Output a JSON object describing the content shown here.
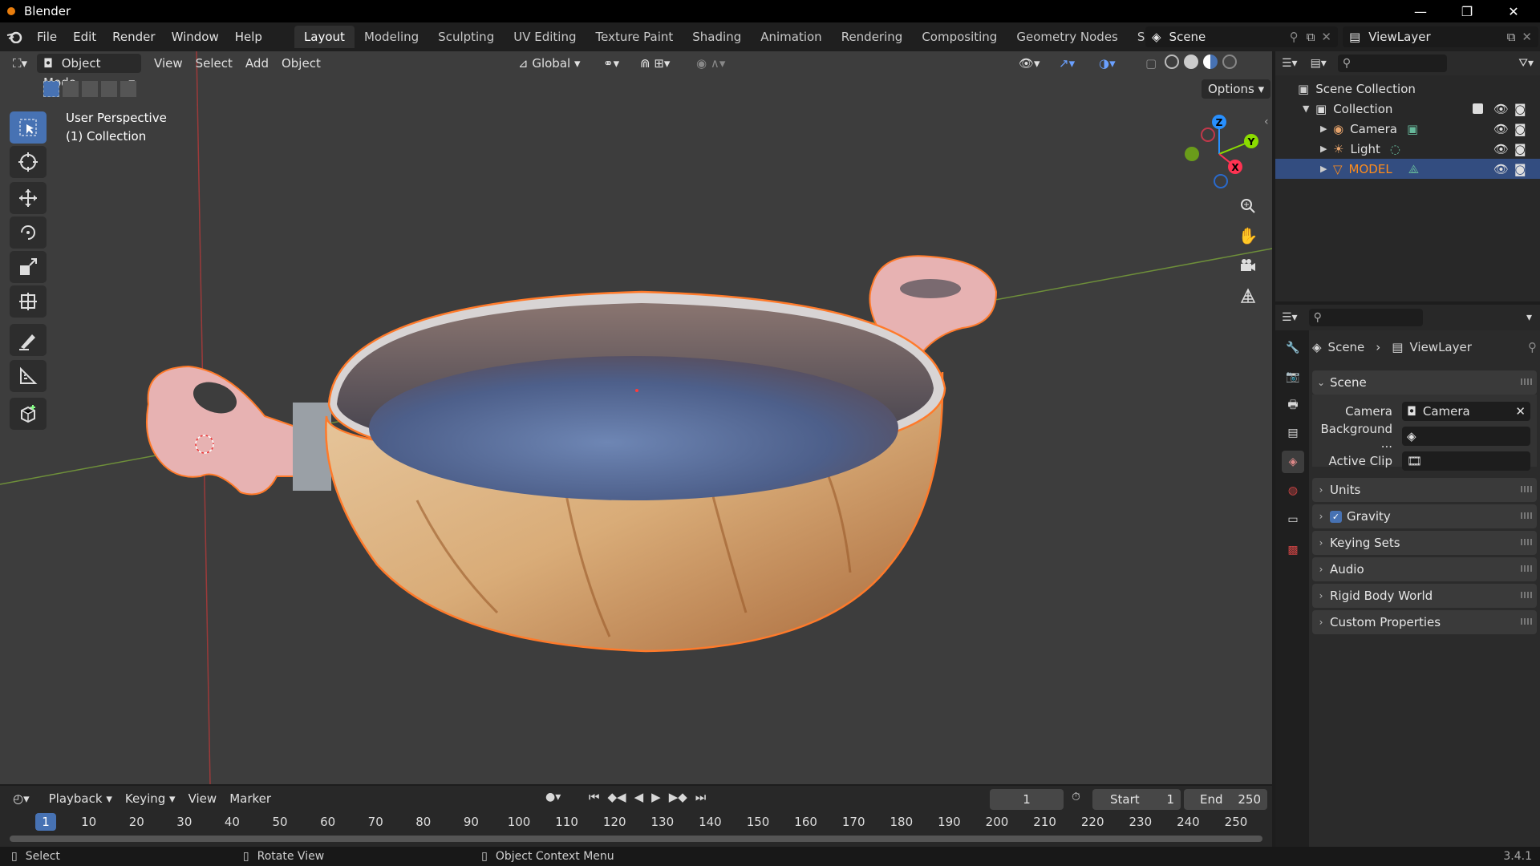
{
  "app": {
    "title": "Blender",
    "version": "3.4.1"
  },
  "menu": [
    "File",
    "Edit",
    "Render",
    "Window",
    "Help"
  ],
  "workspaces": [
    "Layout",
    "Modeling",
    "Sculpting",
    "UV Editing",
    "Texture Paint",
    "Shading",
    "Animation",
    "Rendering",
    "Compositing",
    "Geometry Nodes",
    "Scripting"
  ],
  "active_workspace": "Layout",
  "scene_name": "Scene",
  "view_layer": "ViewLayer",
  "viewport": {
    "mode": "Object Mode",
    "menus": [
      "View",
      "Select",
      "Add",
      "Object"
    ],
    "transform_orientation": "Global",
    "options_label": "Options",
    "overlay_line1": "User Perspective",
    "overlay_line2": "(1) Collection",
    "gizmo_axes": [
      "Z",
      "Y",
      "X"
    ]
  },
  "outliner": {
    "root": "Scene Collection",
    "collection": "Collection",
    "items": [
      {
        "name": "Camera",
        "color": "#e6a36b"
      },
      {
        "name": "Light",
        "color": "#e6a36b"
      },
      {
        "name": "MODEL",
        "color": "#ff8c1a"
      }
    ]
  },
  "properties": {
    "breadcrumb_scene": "Scene",
    "breadcrumb_layer": "ViewLayer",
    "panel_title": "Scene",
    "fields": [
      {
        "label": "Camera",
        "value": "Camera"
      },
      {
        "label": "Background ...",
        "value": ""
      },
      {
        "label": "Active Clip",
        "value": ""
      }
    ],
    "subpanels": [
      "Units",
      "Gravity",
      "Keying Sets",
      "Audio",
      "Rigid Body World",
      "Custom Properties"
    ],
    "gravity_checked": true
  },
  "timeline": {
    "menus": [
      "Playback",
      "Keying",
      "View",
      "Marker"
    ],
    "current_frame": "1",
    "start_label": "Start",
    "start_value": "1",
    "end_label": "End",
    "end_value": "250",
    "ticks": [
      "1",
      "10",
      "20",
      "30",
      "40",
      "50",
      "60",
      "70",
      "80",
      "90",
      "100",
      "110",
      "120",
      "130",
      "140",
      "150",
      "160",
      "170",
      "180",
      "190",
      "200",
      "210",
      "220",
      "230",
      "240",
      "250"
    ]
  },
  "statusbar": {
    "select": "Select",
    "rotate": "Rotate View",
    "context": "Object Context Menu"
  },
  "colors": {
    "accent": "#4772b3",
    "selected_orange": "#ff8c1a",
    "x_axis": "#ff3352",
    "y_axis": "#8bdc00",
    "z_axis": "#2890ff"
  }
}
